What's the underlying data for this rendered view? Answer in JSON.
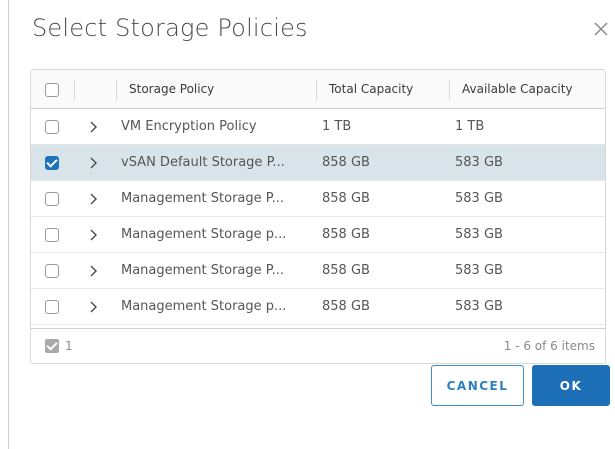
{
  "dialog": {
    "title": "Select Storage Policies",
    "close_icon": "close-icon"
  },
  "grid": {
    "columns": [
      "Storage Policy",
      "Total Capacity",
      "Available Capacity"
    ],
    "rows": [
      {
        "checked": false,
        "name": "VM Encryption Policy",
        "total": "1 TB",
        "available": "1 TB"
      },
      {
        "checked": true,
        "name": "vSAN Default Storage P...",
        "total": "858 GB",
        "available": "583 GB"
      },
      {
        "checked": false,
        "name": "Management Storage P...",
        "total": "858 GB",
        "available": "583 GB"
      },
      {
        "checked": false,
        "name": "Management Storage p...",
        "total": "858 GB",
        "available": "583 GB"
      },
      {
        "checked": false,
        "name": "Management Storage P...",
        "total": "858 GB",
        "available": "583 GB"
      },
      {
        "checked": false,
        "name": "Management Storage p...",
        "total": "858 GB",
        "available": "583 GB"
      }
    ],
    "footer": {
      "selected_count": "1",
      "pagination": "1 - 6 of 6 items"
    }
  },
  "buttons": {
    "cancel_label": "CANCEL",
    "ok_label": "OK"
  },
  "colors": {
    "selected_row": "#d9e4ea",
    "accent": "#1d70b7"
  }
}
